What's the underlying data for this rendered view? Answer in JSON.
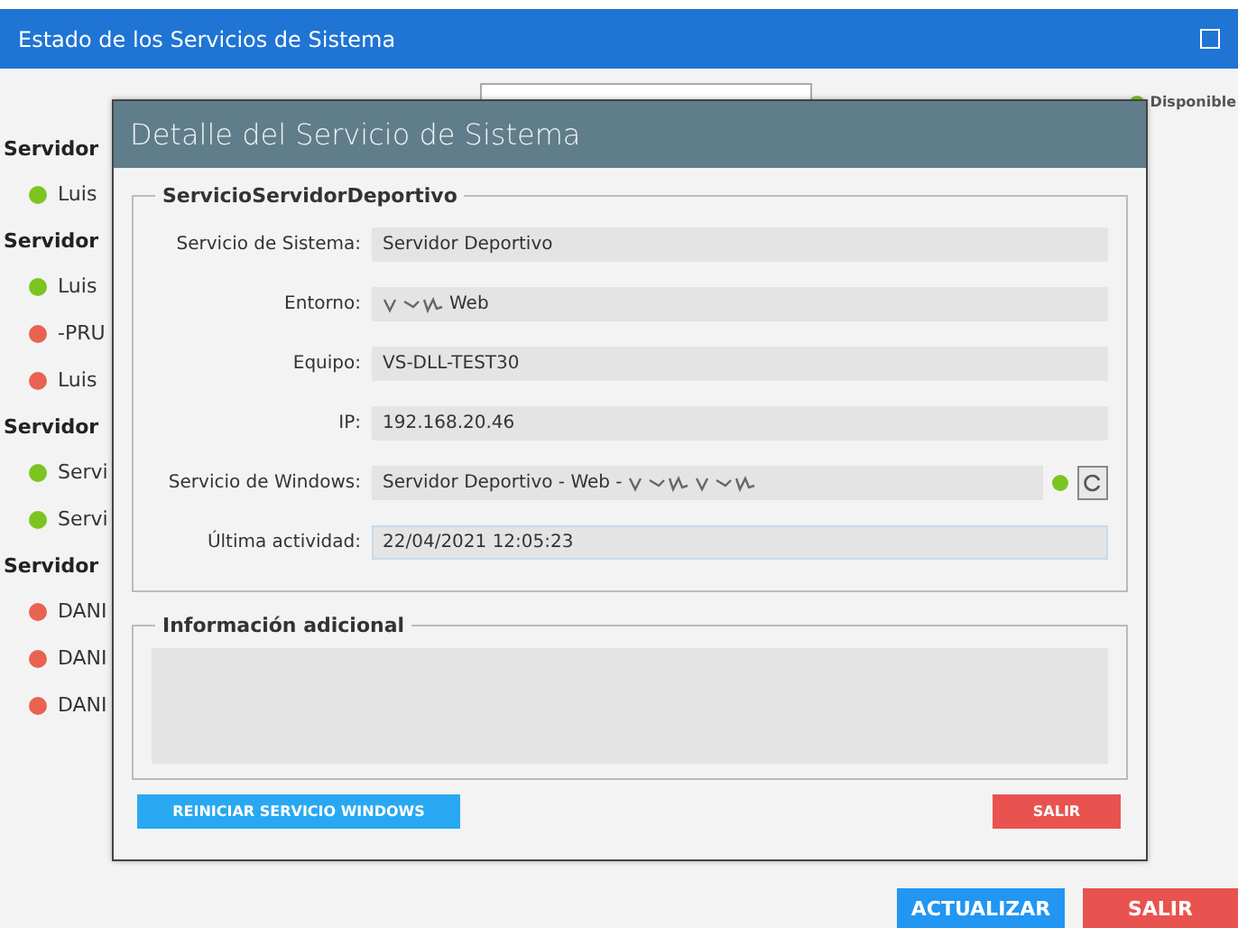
{
  "window": {
    "title": "Estado de los Servicios de Sistema"
  },
  "legend": {
    "label": "Disponible",
    "color": "#7cc520"
  },
  "groups": [
    {
      "title": "Servidor",
      "services": [
        {
          "name": "Luis",
          "available": true
        }
      ]
    },
    {
      "title": "Servidor",
      "services": [
        {
          "name": "Luis",
          "available": true
        },
        {
          "name": "-PRU",
          "available": false
        },
        {
          "name": "Luis",
          "available": false
        }
      ]
    },
    {
      "title": "Servidor",
      "services": [
        {
          "name": "Servi",
          "available": true
        },
        {
          "name": "Servi",
          "available": true
        }
      ]
    },
    {
      "title": "Servidor",
      "services": [
        {
          "name": "DANI",
          "available": false
        },
        {
          "name": "DANI",
          "available": false
        },
        {
          "name": "DANI",
          "available": false
        }
      ]
    }
  ],
  "dialog": {
    "title": "Detalle del Servicio de Sistema",
    "section": "ServicioServidorDeportivo",
    "fields": [
      {
        "label": "Servicio de Sistema:",
        "value": "Servidor Deportivo",
        "kind": "text"
      },
      {
        "label": "Entorno:",
        "value": "Web",
        "kind": "redacted"
      },
      {
        "label": "Equipo:",
        "value": "VS-DLL-TEST30",
        "kind": "text"
      },
      {
        "label": "IP:",
        "value": "192.168.20.46",
        "kind": "text"
      },
      {
        "label": "Servicio de Windows:",
        "value": "Servidor Deportivo - Web -",
        "kind": "service",
        "available": true
      },
      {
        "label": "Última actividad:",
        "value": "22/04/2021 12:05:23",
        "kind": "focused"
      }
    ],
    "extra_title": "Información adicional",
    "restart_button": "REINICIAR SERVICIO WINDOWS",
    "exit_button": "SALIR"
  },
  "buttons": [
    {
      "label": "ACTUALIZAR",
      "kind": "primary"
    },
    {
      "label": "SALIR",
      "kind": "danger"
    }
  ]
}
